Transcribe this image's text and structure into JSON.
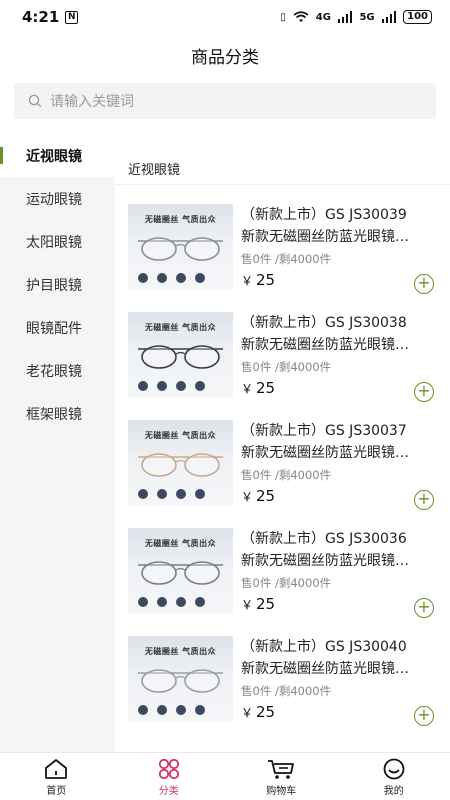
{
  "status_bar": {
    "time": "4:21",
    "nfc": "N",
    "signal1": "4G",
    "signal2": "5G",
    "battery": "100"
  },
  "header": {
    "title": "商品分类"
  },
  "search": {
    "placeholder": "请输入关键词"
  },
  "sidebar": {
    "items": [
      {
        "label": "近视眼镜",
        "active": true
      },
      {
        "label": "运动眼镜"
      },
      {
        "label": "太阳眼镜"
      },
      {
        "label": "护目眼镜"
      },
      {
        "label": "眼镜配件"
      },
      {
        "label": "老花眼镜"
      },
      {
        "label": "框架眼镜"
      }
    ]
  },
  "main": {
    "category_title": "近视眼镜",
    "thumb_caption": "无磁圈丝 气质出众",
    "products": [
      {
        "line1": "（新款上市）GS JS30039",
        "line2": "新款无磁圈丝防蓝光眼镜…",
        "stock": "售0件 /剩4000件",
        "currency": "￥",
        "price": "25",
        "frame_color": "#8a8f96"
      },
      {
        "line1": "（新款上市）GS JS30038",
        "line2": "新款无磁圈丝防蓝光眼镜…",
        "stock": "售0件 /剩4000件",
        "currency": "￥",
        "price": "25",
        "frame_color": "#3a3d42"
      },
      {
        "line1": "（新款上市）GS JS30037",
        "line2": "新款无磁圈丝防蓝光眼镜…",
        "stock": "售0件 /剩4000件",
        "currency": "￥",
        "price": "25",
        "frame_color": "#c9a98a"
      },
      {
        "line1": "（新款上市）GS JS30036",
        "line2": "新款无磁圈丝防蓝光眼镜…",
        "stock": "售0件 /剩4000件",
        "currency": "￥",
        "price": "25",
        "frame_color": "#7a7f86"
      },
      {
        "line1": "（新款上市）GS JS30040",
        "line2": "新款无磁圈丝防蓝光眼镜…",
        "stock": "售0件 /剩4000件",
        "currency": "￥",
        "price": "25",
        "frame_color": "#9a9ea4"
      }
    ]
  },
  "tabbar": {
    "items": [
      {
        "label": "首页",
        "icon": "home-icon"
      },
      {
        "label": "分类",
        "icon": "category-icon",
        "active": true
      },
      {
        "label": "购物车",
        "icon": "cart-icon"
      },
      {
        "label": "我的",
        "icon": "profile-icon"
      }
    ]
  },
  "colors": {
    "accent_green": "#6a8f2d",
    "tab_active": "#d33366"
  }
}
